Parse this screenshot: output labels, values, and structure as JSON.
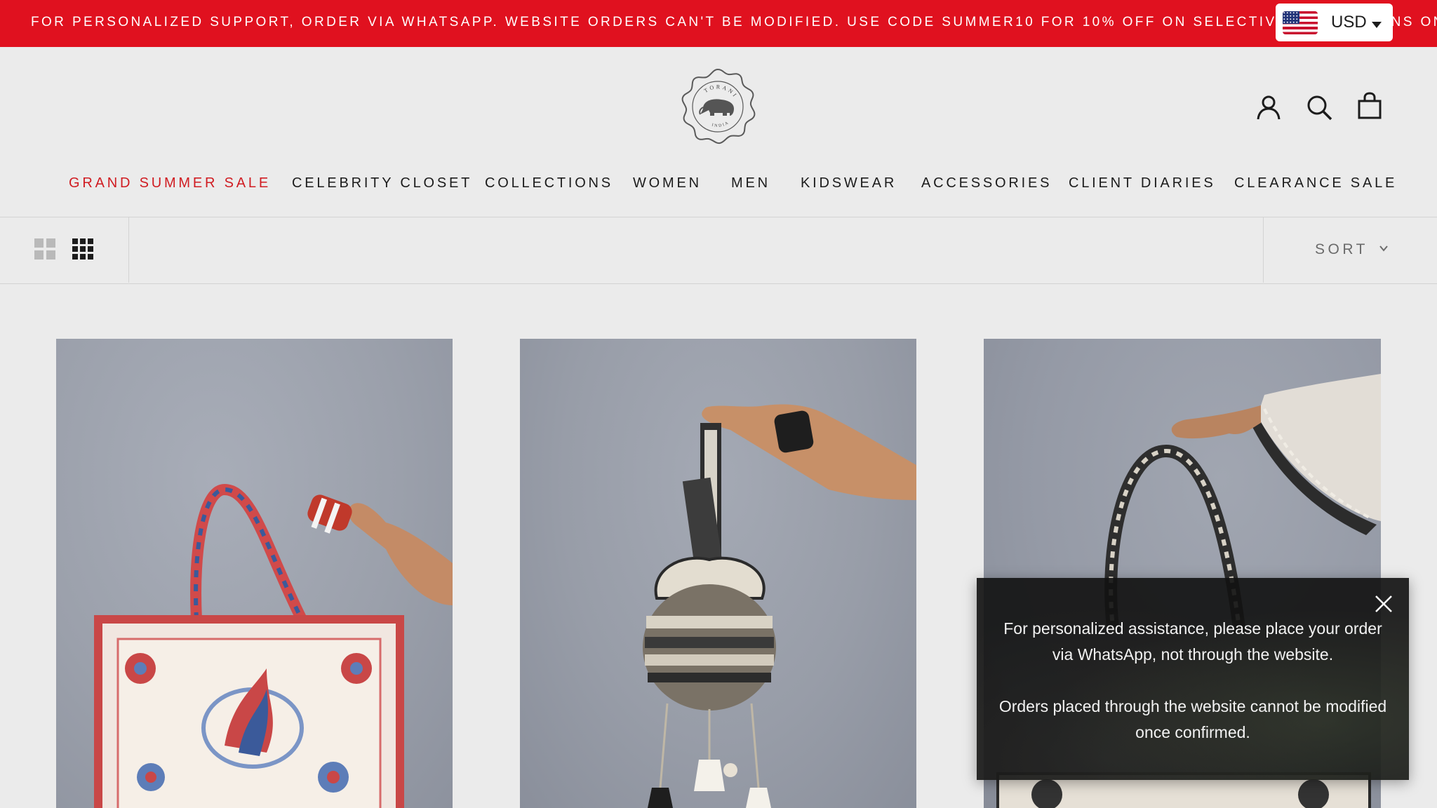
{
  "announcement": {
    "text": "FOR PERSONALIZED SUPPORT, ORDER VIA WHATSAPP. WEBSITE ORDERS CAN'T BE MODIFIED. USE CODE SUMMER10 FOR 10% OFF ON SELECTIVE COLLECTIONS ONLY."
  },
  "currency": {
    "code": "USD",
    "flag_icon": "us-flag-icon"
  },
  "header": {
    "logo_top_text": "TORANI",
    "logo_bottom_text": "INDIA",
    "icons": [
      "account-icon",
      "search-icon",
      "cart-icon"
    ]
  },
  "nav": {
    "items": [
      {
        "label": "GRAND SUMMER SALE",
        "color": "#d01c22"
      },
      {
        "label": "CELEBRITY CLOSET"
      },
      {
        "label": "COLLECTIONS"
      },
      {
        "label": "WOMEN"
      },
      {
        "label": "MEN"
      },
      {
        "label": "KIDSWEAR"
      },
      {
        "label": "ACCESSORIES"
      },
      {
        "label": "CLIENT DIARIES"
      },
      {
        "label": "CLEARANCE SALE"
      }
    ]
  },
  "toolbar": {
    "sort_label": "SORT",
    "view_modes": [
      "grid-2-icon",
      "grid-3-icon"
    ],
    "active_view": "grid-3"
  },
  "products": [
    {
      "image": "red-blue-floral-tote-bag"
    },
    {
      "image": "black-white-potli-bag"
    },
    {
      "image": "black-white-printed-tote-bag"
    }
  ],
  "popup": {
    "line1": "For personalized assistance, please place your order via WhatsApp, not through the website.",
    "line2": "Orders placed through the website cannot be modified once confirmed."
  },
  "colors": {
    "announcement_bg": "#e0111f",
    "page_bg": "#ebebeb",
    "sale_red": "#d01c22"
  }
}
